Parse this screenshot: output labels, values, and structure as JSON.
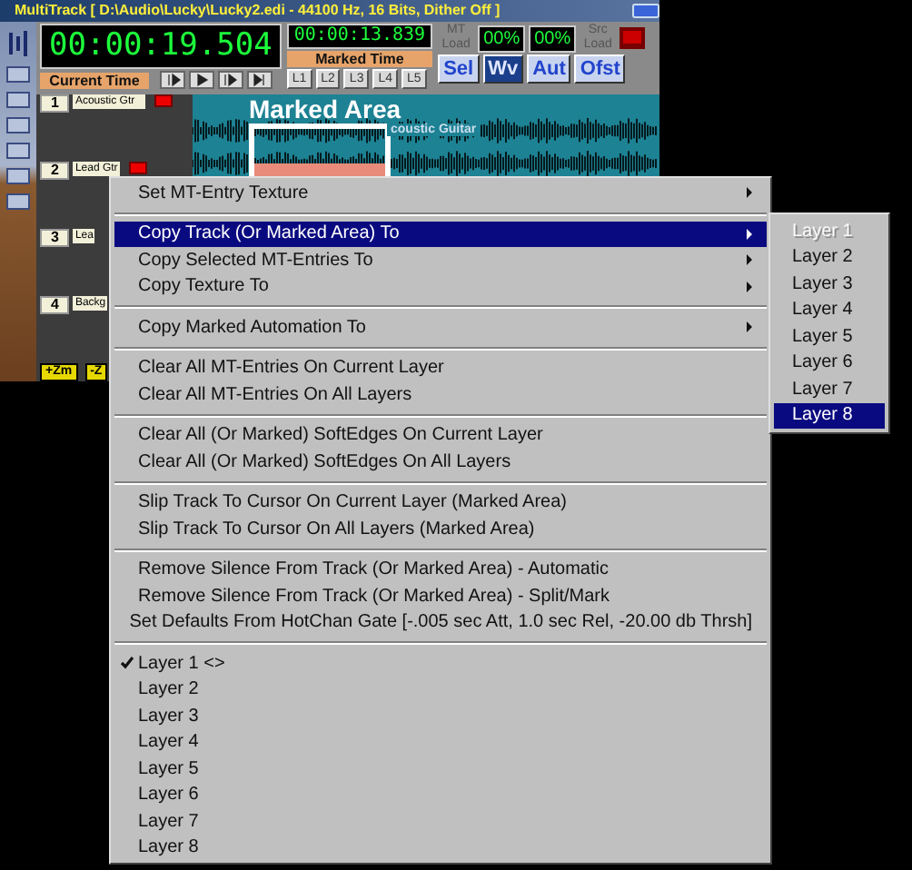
{
  "app": {
    "title": "MultiTrack  [ D:\\Audio\\Lucky\\Lucky2.edi - 44100 Hz, 16 Bits, Dither Off ]",
    "current_time": "00:00:19.504",
    "current_time_label": "Current Time",
    "marked_time": "00:00:13.839",
    "marked_time_label": "Marked Time",
    "mt_load_label": "MT Load",
    "mt_load": "00%",
    "src_load": "00%",
    "src_load_label": "Src Load",
    "layer_buttons": [
      "L1",
      "L2",
      "L3",
      "L4",
      "L5"
    ],
    "view_buttons": [
      {
        "label": "Sel",
        "selected": false
      },
      {
        "label": "Wv",
        "selected": true
      },
      {
        "label": "Aut",
        "selected": false
      },
      {
        "label": "Ofst",
        "selected": false
      }
    ],
    "tracks": [
      {
        "number": "1",
        "name": "Acoustic Gtr",
        "record_button": true
      },
      {
        "number": "2",
        "name": "Lead Gtr",
        "record_button": true
      },
      {
        "number": "3",
        "name": "Lea",
        "record_button": false
      },
      {
        "number": "4",
        "name": "Backg",
        "record_button": false
      }
    ],
    "marked_area_label": "Marked Area",
    "clip_name": "coustic Guitar",
    "zoom_buttons": [
      "+Zm",
      "-Z"
    ]
  },
  "context_menu": {
    "items": [
      {
        "kind": "item",
        "label": "Set MT-Entry Texture",
        "submenu": true,
        "selected": false,
        "checked": false
      },
      {
        "kind": "separator"
      },
      {
        "kind": "item",
        "label": "Copy Track (Or Marked Area) To",
        "submenu": true,
        "selected": true,
        "checked": false
      },
      {
        "kind": "item",
        "label": "Copy Selected MT-Entries To",
        "submenu": true,
        "selected": false,
        "checked": false
      },
      {
        "kind": "item",
        "label": "Copy Texture To",
        "submenu": true,
        "selected": false,
        "checked": false
      },
      {
        "kind": "separator"
      },
      {
        "kind": "item",
        "label": "Copy Marked Automation To",
        "submenu": true,
        "selected": false,
        "checked": false
      },
      {
        "kind": "separator"
      },
      {
        "kind": "item",
        "label": "Clear All MT-Entries On Current Layer",
        "submenu": false,
        "selected": false,
        "checked": false
      },
      {
        "kind": "item",
        "label": "Clear All MT-Entries On All Layers",
        "submenu": false,
        "selected": false,
        "checked": false
      },
      {
        "kind": "separator"
      },
      {
        "kind": "item",
        "label": "Clear All (Or Marked) SoftEdges On Current Layer",
        "submenu": false,
        "selected": false,
        "checked": false
      },
      {
        "kind": "item",
        "label": "Clear All (Or Marked) SoftEdges On All Layers",
        "submenu": false,
        "selected": false,
        "checked": false
      },
      {
        "kind": "separator"
      },
      {
        "kind": "item",
        "label": "Slip Track To Cursor On Current Layer (Marked Area)",
        "submenu": false,
        "selected": false,
        "checked": false
      },
      {
        "kind": "item",
        "label": "Slip Track To Cursor On All Layers (Marked Area)",
        "submenu": false,
        "selected": false,
        "checked": false
      },
      {
        "kind": "separator"
      },
      {
        "kind": "item",
        "label": "Remove Silence From Track (Or Marked Area) - Automatic",
        "submenu": false,
        "selected": false,
        "checked": false
      },
      {
        "kind": "item",
        "label": "Remove Silence From Track (Or Marked Area) - Split/Mark",
        "submenu": false,
        "selected": false,
        "checked": false
      },
      {
        "kind": "item",
        "label": "Set Defaults From HotChan Gate [-.005 sec Att, 1.0 sec Rel, -20.00 db Thrsh]",
        "submenu": false,
        "selected": false,
        "checked": false
      },
      {
        "kind": "separator"
      },
      {
        "kind": "item",
        "label": "Layer 1 <>",
        "submenu": false,
        "selected": false,
        "checked": true
      },
      {
        "kind": "item",
        "label": "Layer 2",
        "submenu": false,
        "selected": false,
        "checked": false
      },
      {
        "kind": "item",
        "label": "Layer 3",
        "submenu": false,
        "selected": false,
        "checked": false
      },
      {
        "kind": "item",
        "label": "Layer 4",
        "submenu": false,
        "selected": false,
        "checked": false
      },
      {
        "kind": "item",
        "label": "Layer 5",
        "submenu": false,
        "selected": false,
        "checked": false
      },
      {
        "kind": "item",
        "label": "Layer 6",
        "submenu": false,
        "selected": false,
        "checked": false
      },
      {
        "kind": "item",
        "label": "Layer 7",
        "submenu": false,
        "selected": false,
        "checked": false
      },
      {
        "kind": "item",
        "label": "Layer 8",
        "submenu": false,
        "selected": false,
        "checked": false
      }
    ]
  },
  "submenu": {
    "items": [
      {
        "label": "Layer 1",
        "disabled": true,
        "selected": false
      },
      {
        "label": "Layer 2",
        "disabled": false,
        "selected": false
      },
      {
        "label": "Layer 3",
        "disabled": false,
        "selected": false
      },
      {
        "label": "Layer 4",
        "disabled": false,
        "selected": false
      },
      {
        "label": "Layer 5",
        "disabled": false,
        "selected": false
      },
      {
        "label": "Layer 6",
        "disabled": false,
        "selected": false
      },
      {
        "label": "Layer 7",
        "disabled": false,
        "selected": false
      },
      {
        "label": "Layer 8",
        "disabled": false,
        "selected": true
      }
    ]
  }
}
